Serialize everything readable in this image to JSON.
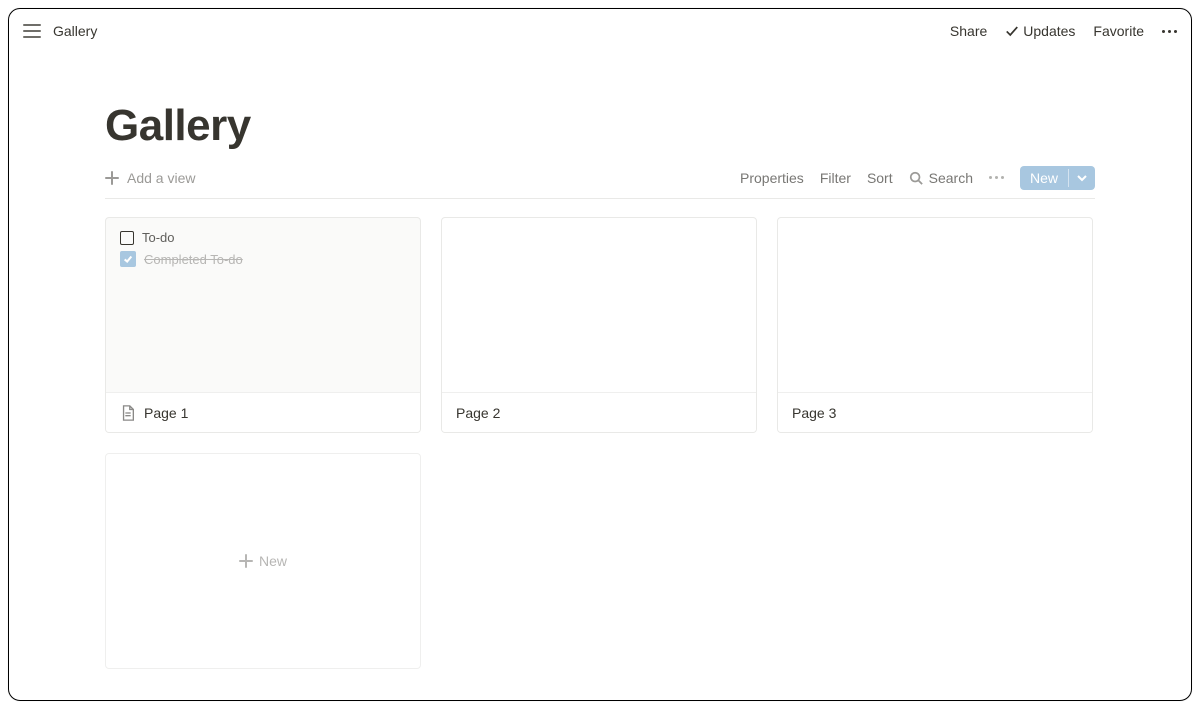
{
  "topbar": {
    "breadcrumb": "Gallery",
    "share": "Share",
    "updates": "Updates",
    "favorite": "Favorite"
  },
  "page": {
    "title": "Gallery"
  },
  "view_toolbar": {
    "add_view": "Add a view",
    "properties": "Properties",
    "filter": "Filter",
    "sort": "Sort",
    "search": "Search",
    "new": "New"
  },
  "cards": [
    {
      "title": "Page 1",
      "todos": [
        {
          "label": "To-do",
          "done": false
        },
        {
          "label": "Completed To-do",
          "done": true
        }
      ],
      "has_icon": true,
      "shaded": true
    },
    {
      "title": "Page 2",
      "todos": [],
      "has_icon": false,
      "shaded": false
    },
    {
      "title": "Page 3",
      "todos": [],
      "has_icon": false,
      "shaded": false
    }
  ],
  "new_card_label": "New",
  "colors": {
    "accent": "#a8c7e0",
    "border": "#e9e9e7",
    "text": "#37352f",
    "muted": "#9b9a97"
  }
}
